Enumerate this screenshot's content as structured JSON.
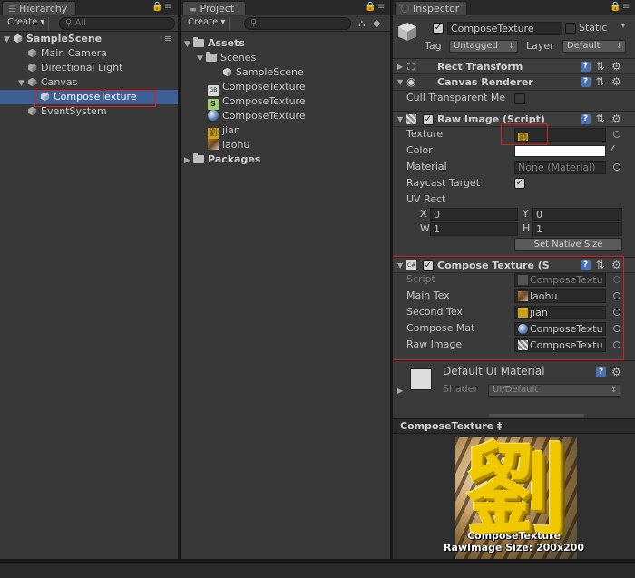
{
  "hierarchy": {
    "tab": "Hierarchy",
    "create_label": "Create ▾",
    "search_placeholder": "All",
    "scene": "SampleScene",
    "items": [
      "Main Camera",
      "Directional Light",
      "Canvas",
      "ComposeTexture",
      "EventSystem"
    ]
  },
  "project": {
    "tab": "Project",
    "create_label": "Create ▾",
    "assets_label": "Assets",
    "scenes_label": "Scenes",
    "scene_file": "SampleScene",
    "files": [
      "ComposeTexture",
      "ComposeTexture",
      "ComposeTexture",
      "jian",
      "laohu"
    ],
    "packages_label": "Packages"
  },
  "inspector": {
    "tab": "Inspector",
    "object_name": "ComposeTexture",
    "static_label": "Static",
    "tag_label": "Tag",
    "tag_value": "Untagged",
    "layer_label": "Layer",
    "layer_value": "Default",
    "rect_transform": "Rect Transform",
    "canvas_renderer": "Canvas Renderer",
    "cull_label": "Cull Transparent Me",
    "raw_image": {
      "title": "Raw Image (Script)",
      "texture_label": "Texture",
      "texture_value": "劉",
      "color_label": "Color",
      "material_label": "Material",
      "material_value": "None (Material)",
      "raycast_label": "Raycast Target",
      "uvrect_label": "UV Rect",
      "x_label": "X",
      "x_value": "0",
      "y_label": "Y",
      "y_value": "0",
      "w_label": "W",
      "w_value": "1",
      "h_label": "H",
      "h_value": "1",
      "native_size": "Set Native Size"
    },
    "compose": {
      "title": "Compose Texture (S",
      "script_label": "Script",
      "script_value": "ComposeTextu",
      "main_label": "Main Tex",
      "main_value": "laohu",
      "second_label": "Second Tex",
      "second_value": "jian",
      "mat_label": "Compose Mat",
      "mat_value": "ComposeTextu",
      "raw_label": "Raw Image",
      "raw_value": "ComposeTextu"
    },
    "material": {
      "title": "Default UI Material",
      "shader_label": "Shader",
      "shader_value": "UI/Default"
    },
    "preview": {
      "header": "ComposeTexture ‡",
      "char": "劉",
      "caption1": "ComposeTexture",
      "caption2": "RawImage Size: 200x200"
    }
  },
  "colors": {
    "selection": "#3d5f96",
    "highlight_box": "#e01e1e",
    "help_badge": "#4970b0"
  }
}
